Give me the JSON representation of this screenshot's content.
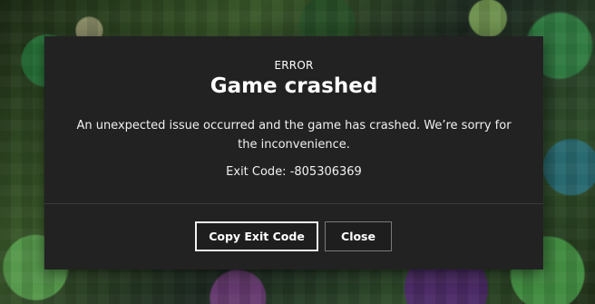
{
  "dialog": {
    "eyebrow": "ERROR",
    "title": "Game crashed",
    "message": "An unexpected issue occurred and the game has crashed. We’re sorry for the inconvenience.",
    "exit_code_text": "Exit Code: -805306369"
  },
  "buttons": {
    "copy_label": "Copy Exit Code",
    "close_label": "Close"
  },
  "colors": {
    "dialog_bg": "#222222",
    "text": "#ffffff",
    "button_bg": "#1e1e1e"
  }
}
